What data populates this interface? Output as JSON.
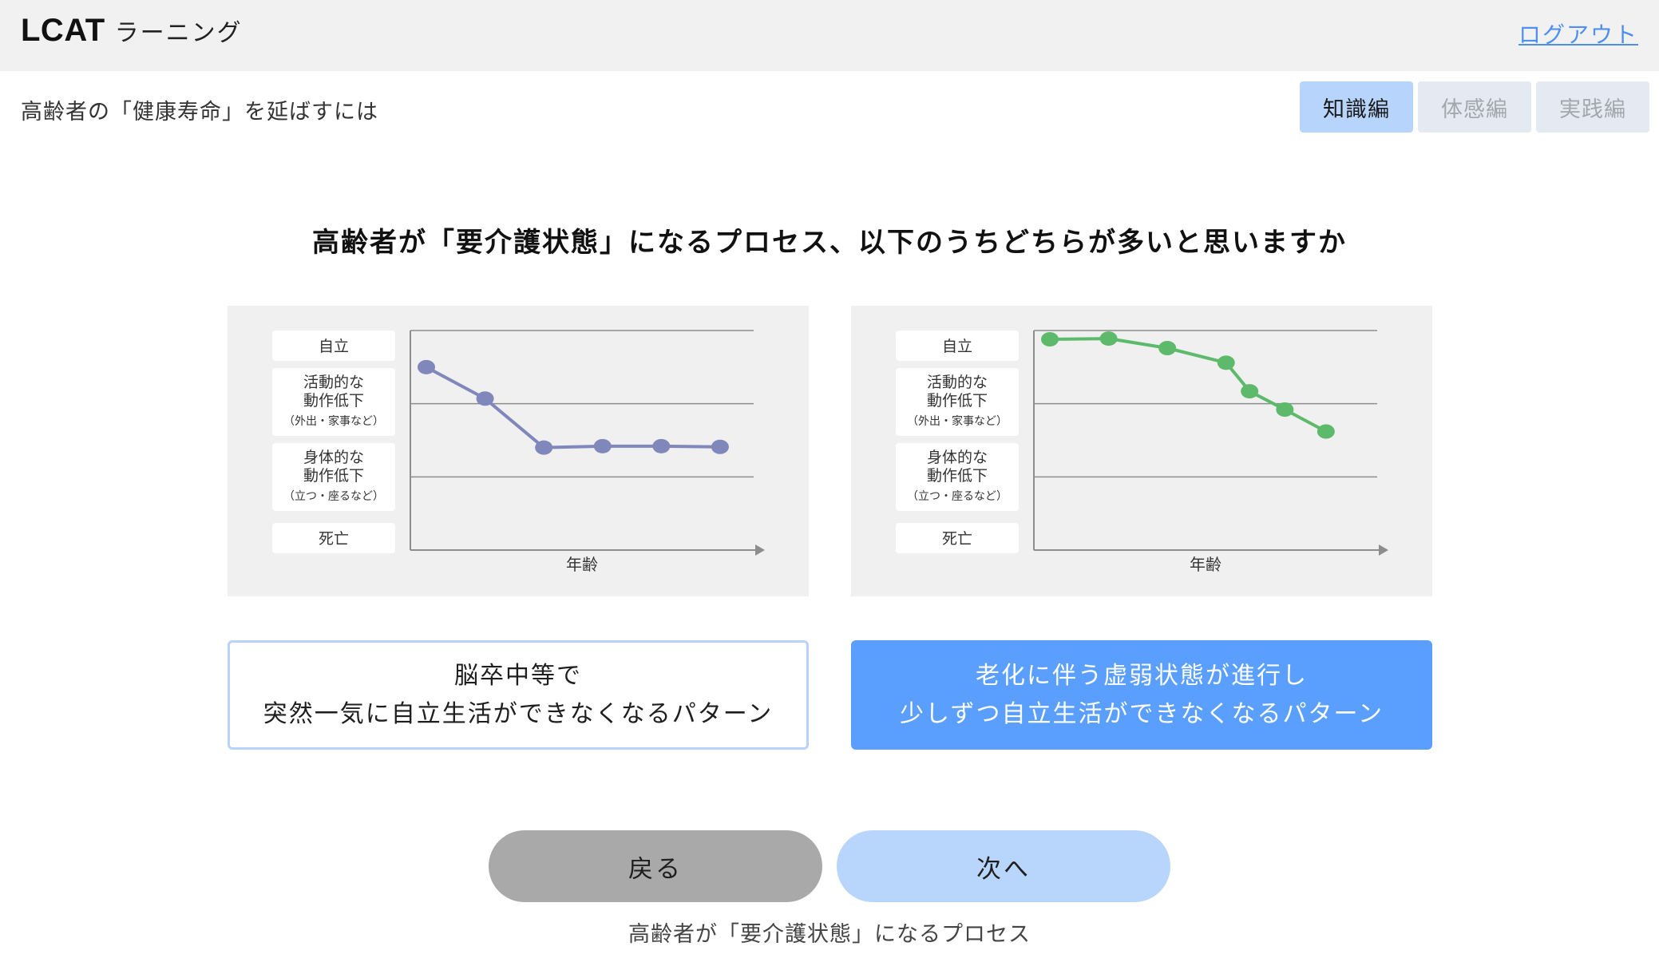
{
  "header": {
    "brand": "LCAT",
    "brand_sub": "ラーニング",
    "logout": "ログアウト"
  },
  "page": {
    "subtitle": "高齢者の「健康寿命」を延ばすには"
  },
  "tabs": [
    {
      "label": "知識編",
      "active": true
    },
    {
      "label": "体感編",
      "active": false
    },
    {
      "label": "実践編",
      "active": false
    }
  ],
  "question": "高齢者が「要介護状態」になるプロセス、以下のうちどちらが多いと思いますか",
  "chart_data": [
    {
      "type": "line",
      "xlabel": "年齢",
      "ylabel_levels": [
        {
          "lines": [
            "自立"
          ],
          "note": ""
        },
        {
          "lines": [
            "活動的な",
            "動作低下"
          ],
          "note": "（外出・家事など）"
        },
        {
          "lines": [
            "身体的な",
            "動作低下"
          ],
          "note": "（立つ・座るなど）"
        },
        {
          "lines": [
            "死亡"
          ],
          "note": ""
        }
      ],
      "ylim": [
        0,
        3
      ],
      "color": "#7f87bb",
      "x": [
        1,
        2,
        3,
        4,
        5,
        6
      ],
      "values": [
        2.5,
        2.07,
        1.4,
        1.42,
        1.42,
        1.41
      ]
    },
    {
      "type": "line",
      "xlabel": "年齢",
      "ylabel_levels": [
        {
          "lines": [
            "自立"
          ],
          "note": ""
        },
        {
          "lines": [
            "活動的な",
            "動作低下"
          ],
          "note": "（外出・家事など）"
        },
        {
          "lines": [
            "身体的な",
            "動作低下"
          ],
          "note": "（立つ・座るなど）"
        },
        {
          "lines": [
            "死亡"
          ],
          "note": ""
        }
      ],
      "ylim": [
        0,
        3
      ],
      "color": "#5dba6b",
      "x": [
        1,
        2,
        3,
        4,
        4.4,
        5,
        5.7
      ],
      "values": [
        2.88,
        2.89,
        2.76,
        2.56,
        2.17,
        1.92,
        1.62
      ]
    }
  ],
  "options": [
    {
      "lines": [
        "脳卒中等で",
        "突然一気に自立生活ができなくなるパターン"
      ],
      "selected": false
    },
    {
      "lines": [
        "老化に伴う虚弱状態が進行し",
        "少しずつ自立生活ができなくなるパターン"
      ],
      "selected": true
    }
  ],
  "nav": {
    "back": "戻る",
    "next": "次へ"
  },
  "caption": "高齢者が「要介護状態」になるプロセス"
}
